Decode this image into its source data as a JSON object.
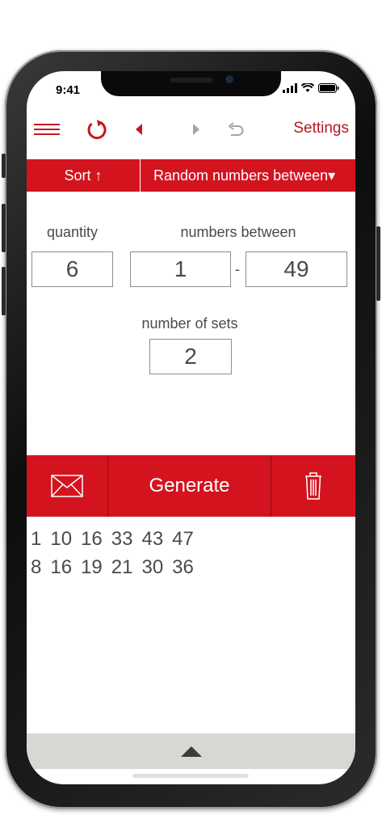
{
  "status": {
    "time": "9:41"
  },
  "toolbar": {
    "settings_label": "Settings"
  },
  "tabs": {
    "sort_label": "Sort ↑",
    "mode_label": "Random numbers between▾"
  },
  "form": {
    "quantity_label": "quantity",
    "quantity_value": "6",
    "range_label": "numbers between",
    "range_min": "1",
    "range_separator": "-",
    "range_max": "49",
    "sets_label": "number of sets",
    "sets_value": "2"
  },
  "actions": {
    "generate_label": "Generate"
  },
  "results": [
    [
      "1",
      "10",
      "16",
      "33",
      "43",
      "47"
    ],
    [
      "8",
      "16",
      "19",
      "21",
      "30",
      "36"
    ]
  ],
  "colors": {
    "accent": "#d3141f",
    "text": "#4a4a4a",
    "bottom_bar": "#d8d8d2"
  },
  "icons": [
    "menu-icon",
    "refresh-icon",
    "back-icon",
    "forward-icon",
    "undo-icon",
    "mail-icon",
    "trash-icon",
    "chevron-up-icon"
  ]
}
